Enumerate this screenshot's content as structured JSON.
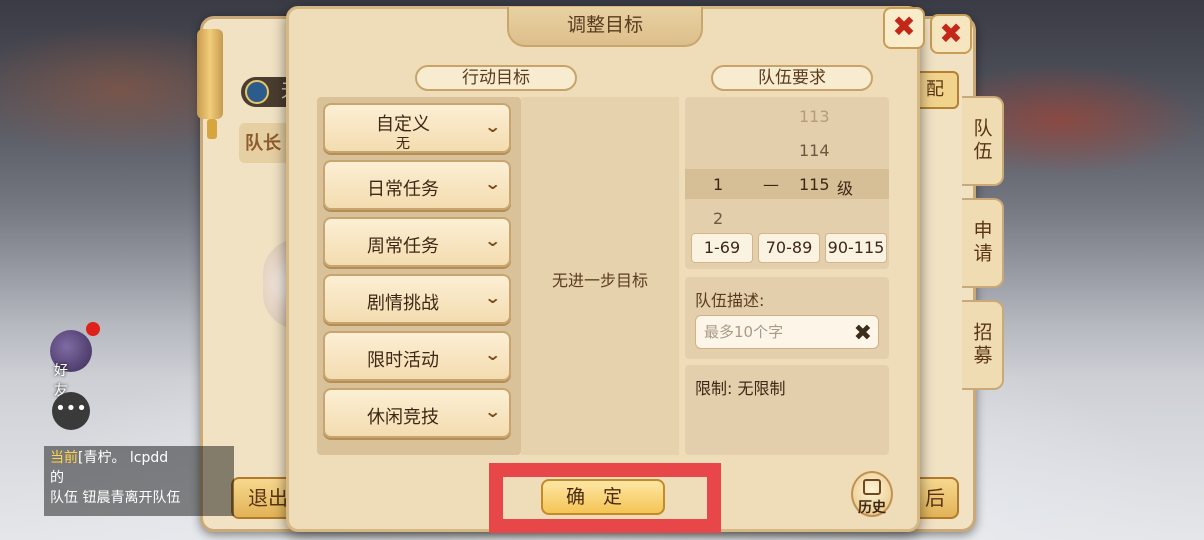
{
  "dialog": {
    "title": "调整目标",
    "action_section_label": "行动目标",
    "team_section_label": "队伍要求",
    "goals": [
      {
        "label": "自定义",
        "sub": "无"
      },
      {
        "label": "日常任务"
      },
      {
        "label": "周常任务"
      },
      {
        "label": "剧情挑战"
      },
      {
        "label": "限时活动"
      },
      {
        "label": "休闲竞技"
      }
    ],
    "middle_text": "无进一步目标",
    "level_picker": {
      "rows": [
        "113",
        "114",
        "2"
      ],
      "selected": {
        "min": "1",
        "dash": "—",
        "max": "115",
        "unit": "级"
      }
    },
    "ranges": [
      "1-69",
      "70-89",
      "90-115"
    ],
    "description": {
      "label": "队伍描述:",
      "placeholder": "最多10个字"
    },
    "limit": "限制: 无限制",
    "confirm": "确定",
    "history": "历史",
    "close_icon": "close-icon",
    "chevron_icon": "chevron-down-icon"
  },
  "background": {
    "rank_chip": "无",
    "leader_label": "队长",
    "right_button": "配",
    "exit_button": "退出",
    "bottom_right_button": "后",
    "side_tabs": [
      "队伍",
      "申请",
      "招募"
    ],
    "friend_label": "好友",
    "chat": {
      "line1_tag": "当前",
      "line1": "[青柠。 lcpdd",
      "line2": "的",
      "line3_tag": "队伍",
      "line3": "钮晨青离开队伍"
    }
  },
  "colors": {
    "close_red": "#c42718",
    "highlight_red": "#e8474a",
    "panel_beige": "#efddb9"
  }
}
